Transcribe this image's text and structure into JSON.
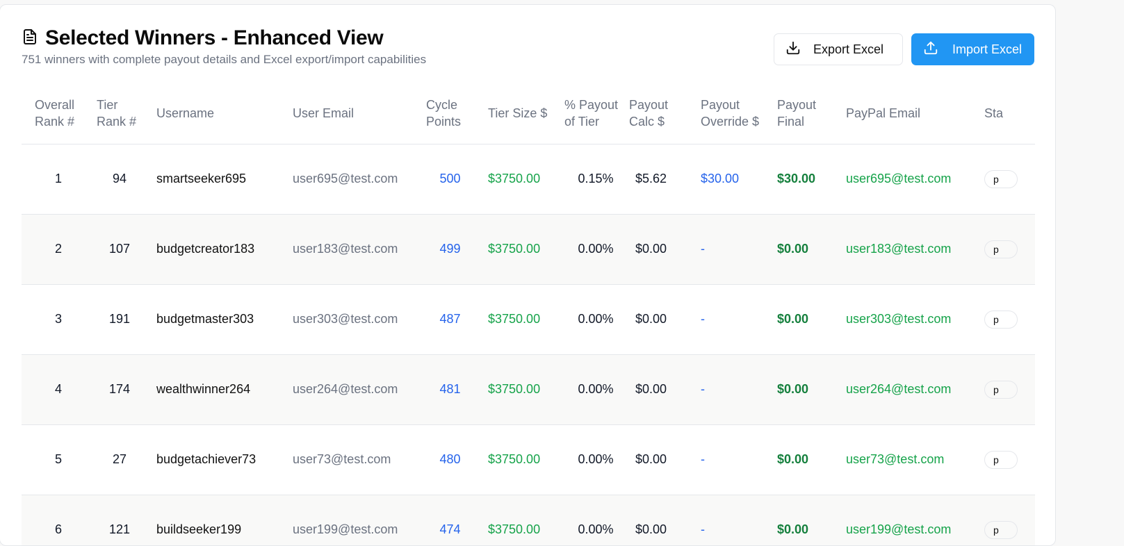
{
  "header": {
    "title": "Selected Winners - Enhanced View",
    "subtitle": "751 winners with complete payout details and Excel export/import capabilities",
    "title_icon": "document-icon",
    "export_label": "Export Excel",
    "import_label": "Import Excel",
    "export_icon": "download-icon",
    "import_icon": "upload-icon"
  },
  "colors": {
    "accent": "#2196f3",
    "green": "#16a34a",
    "blue_value": "#2563eb"
  },
  "table": {
    "columns": {
      "overall_rank": "Overall Rank #",
      "tier_rank": "Tier Rank #",
      "username": "Username",
      "user_email": "User Email",
      "cycle_points": "Cycle Points",
      "tier_size": "Tier Size $",
      "pct_payout": "% Payout of Tier",
      "payout_calc": "Payout Calc $",
      "payout_override": "Payout Override $",
      "payout_final": "Payout Final",
      "paypal_email": "PayPal Email",
      "status": "Sta"
    },
    "rows": [
      {
        "overall_rank": "1",
        "tier_rank": "94",
        "username": "smartseeker695",
        "user_email": "user695@test.com",
        "cycle_points": "500",
        "tier_size": "$3750.00",
        "pct_payout": "0.15%",
        "payout_calc": "$5.62",
        "payout_override": "$30.00",
        "payout_final": "$30.00",
        "paypal_email": "user695@test.com",
        "status": "p"
      },
      {
        "overall_rank": "2",
        "tier_rank": "107",
        "username": "budgetcreator183",
        "user_email": "user183@test.com",
        "cycle_points": "499",
        "tier_size": "$3750.00",
        "pct_payout": "0.00%",
        "payout_calc": "$0.00",
        "payout_override": "-",
        "payout_final": "$0.00",
        "paypal_email": "user183@test.com",
        "status": "p"
      },
      {
        "overall_rank": "3",
        "tier_rank": "191",
        "username": "budgetmaster303",
        "user_email": "user303@test.com",
        "cycle_points": "487",
        "tier_size": "$3750.00",
        "pct_payout": "0.00%",
        "payout_calc": "$0.00",
        "payout_override": "-",
        "payout_final": "$0.00",
        "paypal_email": "user303@test.com",
        "status": "p"
      },
      {
        "overall_rank": "4",
        "tier_rank": "174",
        "username": "wealthwinner264",
        "user_email": "user264@test.com",
        "cycle_points": "481",
        "tier_size": "$3750.00",
        "pct_payout": "0.00%",
        "payout_calc": "$0.00",
        "payout_override": "-",
        "payout_final": "$0.00",
        "paypal_email": "user264@test.com",
        "status": "p"
      },
      {
        "overall_rank": "5",
        "tier_rank": "27",
        "username": "budgetachiever73",
        "user_email": "user73@test.com",
        "cycle_points": "480",
        "tier_size": "$3750.00",
        "pct_payout": "0.00%",
        "payout_calc": "$0.00",
        "payout_override": "-",
        "payout_final": "$0.00",
        "paypal_email": "user73@test.com",
        "status": "p"
      },
      {
        "overall_rank": "6",
        "tier_rank": "121",
        "username": "buildseeker199",
        "user_email": "user199@test.com",
        "cycle_points": "474",
        "tier_size": "$3750.00",
        "pct_payout": "0.00%",
        "payout_calc": "$0.00",
        "payout_override": "-",
        "payout_final": "$0.00",
        "paypal_email": "user199@test.com",
        "status": "p"
      }
    ]
  }
}
